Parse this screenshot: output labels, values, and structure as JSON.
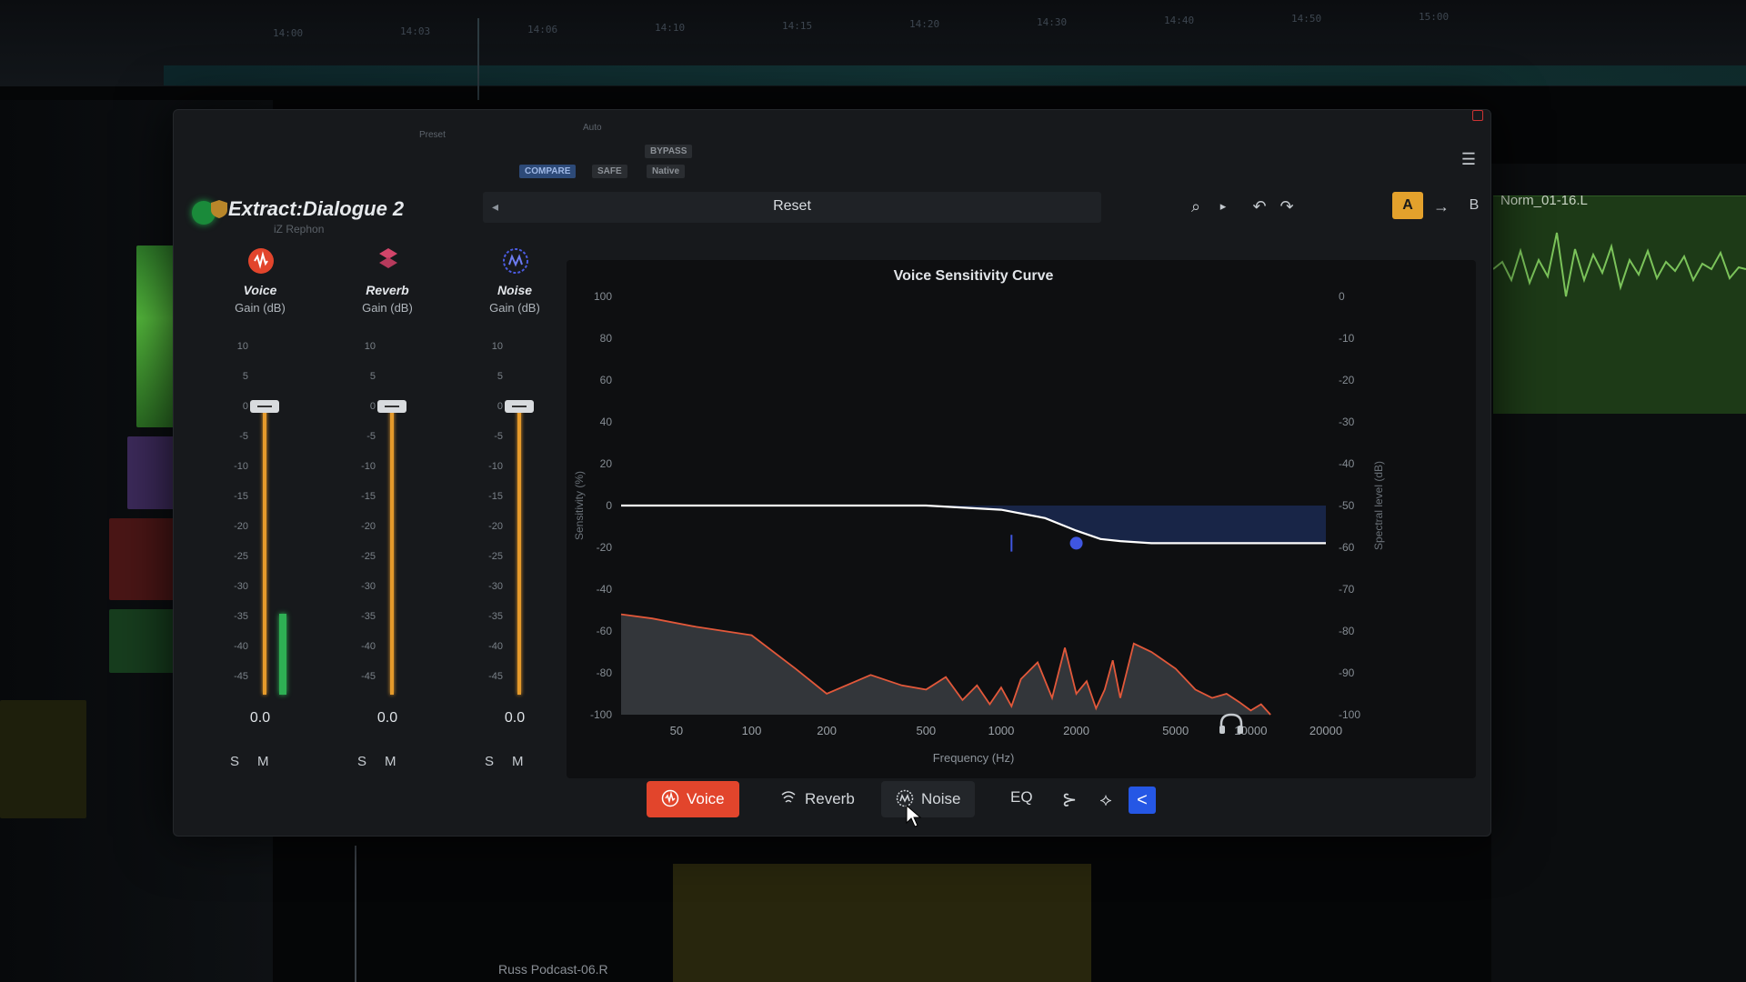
{
  "daw": {
    "ruler_ticks": [
      "14:00",
      "14:03",
      "14:06",
      "14:10",
      "14:15",
      "14:20",
      "14:30",
      "14:40",
      "14:50",
      "15:00"
    ],
    "right_track_label": "Norm_01-16.L",
    "bottom_clip_label": "Russ Podcast-06.R"
  },
  "host": {
    "preset_label": "Preset",
    "auto_label": "Auto",
    "compare_label": "COMPARE",
    "safe_label": "SAFE",
    "native_label": "Native",
    "bypass_label": "BYPASS"
  },
  "plugin": {
    "title": "Extract:Dialogue 2",
    "subtitle": "iZ Rephon",
    "toolbar": {
      "reset_label": "Reset",
      "a_label": "A",
      "b_label": "B",
      "arrow_label": "→"
    },
    "faders": [
      {
        "name": "Voice",
        "unit": "Gain (dB)",
        "value": "0.0",
        "level_fraction": 1.0,
        "meter_fraction": 0.28,
        "s_label": "S",
        "m_label": "M",
        "icon": "voice-icon",
        "color": "#e2452c",
        "scale": [
          "10",
          "5",
          "0",
          "-5",
          "-10",
          "-15",
          "-20",
          "-25",
          "-30",
          "-35",
          "-40",
          "-45"
        ]
      },
      {
        "name": "Reverb",
        "unit": "Gain (dB)",
        "value": "0.0",
        "level_fraction": 1.0,
        "meter_fraction": 0.0,
        "s_label": "S",
        "m_label": "M",
        "icon": "reverb-icon",
        "color": "#d2456a",
        "scale": [
          "10",
          "5",
          "0",
          "-5",
          "-10",
          "-15",
          "-20",
          "-25",
          "-30",
          "-35",
          "-40",
          "-45"
        ]
      },
      {
        "name": "Noise",
        "unit": "Gain (dB)",
        "value": "0.0",
        "level_fraction": 1.0,
        "meter_fraction": 0.0,
        "s_label": "S",
        "m_label": "M",
        "icon": "noise-icon",
        "color": "#4b5be0",
        "scale": [
          "10",
          "5",
          "0",
          "-5",
          "-10",
          "-15",
          "-20",
          "-25",
          "-30",
          "-35",
          "-40",
          "-45"
        ]
      }
    ],
    "modes": {
      "voice_label": "Voice",
      "reverb_label": "Reverb",
      "noise_label": "Noise",
      "eq_label": "EQ",
      "active": "Voice"
    }
  },
  "chart_data": {
    "type": "line",
    "title": "Voice Sensitivity Curve",
    "xlabel": "Frequency (Hz)",
    "ylabel": "Sensitivity (%)",
    "y2label": "Spectral level (dB)",
    "x_scale": "log",
    "xlim": [
      30,
      20000
    ],
    "x_ticks": [
      "50",
      "100",
      "200",
      "500",
      "1000",
      "2000",
      "5000",
      "10000",
      "20000"
    ],
    "ylim": [
      -100,
      100
    ],
    "y_ticks": [
      "100",
      "80",
      "60",
      "40",
      "20",
      "0",
      "-20",
      "-40",
      "-60",
      "-80",
      "-100"
    ],
    "y2lim": [
      -100,
      0
    ],
    "y2_ticks": [
      "0",
      "-10",
      "-20",
      "-30",
      "-40",
      "-50",
      "-60",
      "-70",
      "-80",
      "-90",
      "-100"
    ],
    "series": [
      {
        "values_x": [
          30,
          500,
          1000,
          1500,
          2000,
          2500,
          3000,
          4000,
          5000,
          20000
        ],
        "values_y": [
          0,
          0,
          -2,
          -6,
          -12,
          -16,
          -17,
          -18,
          -18,
          -18
        ],
        "color": "#ffffff"
      },
      {
        "values_x": [
          30,
          40,
          60,
          100,
          150,
          200,
          300,
          400,
          500,
          600,
          700,
          800,
          900,
          1000,
          1100,
          1200,
          1400,
          1600,
          1800,
          2000,
          2200,
          2400,
          2600,
          2800,
          3000,
          3400,
          4000,
          5000,
          6000,
          7000,
          8000,
          9000,
          10000,
          11000,
          12000
        ],
        "values_y": [
          -52,
          -54,
          -58,
          -62,
          -78,
          -90,
          -81,
          -86,
          -88,
          -82,
          -93,
          -86,
          -95,
          -87,
          -96,
          -83,
          -75,
          -92,
          -68,
          -90,
          -84,
          -97,
          -88,
          -74,
          -92,
          -66,
          -70,
          -78,
          -88,
          -92,
          -90,
          -94,
          -98,
          -95,
          -100
        ],
        "color": "#e2583a"
      }
    ],
    "control_point": {
      "x": 2000,
      "y": -18
    },
    "marker_x": 1100
  }
}
